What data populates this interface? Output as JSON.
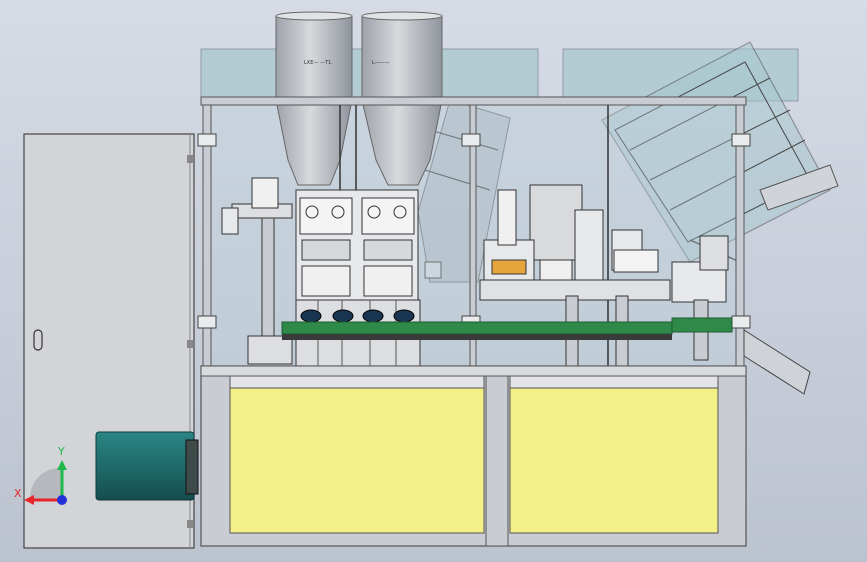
{
  "viewport": {
    "background_top": "#d6dbe5",
    "background_bottom": "#bcc3d0"
  },
  "triad": {
    "x_label": "X",
    "y_label": "Y",
    "x_color": "#e8262b",
    "y_color": "#1fb84a",
    "z_color": "#2531d8"
  },
  "machine": {
    "panel_color": "#f4f088",
    "frame_color": "#c9ccd2",
    "cabinet_color": "#d2d4d8",
    "motor_color": "#1f6a6b",
    "glass_color": "#a9c8cf",
    "conveyor_color": "#2f8a4a",
    "hopper_color": "#c2c5cb",
    "hopper_left_label": "LXE— —T1.",
    "hopper_right_label": "L———"
  }
}
